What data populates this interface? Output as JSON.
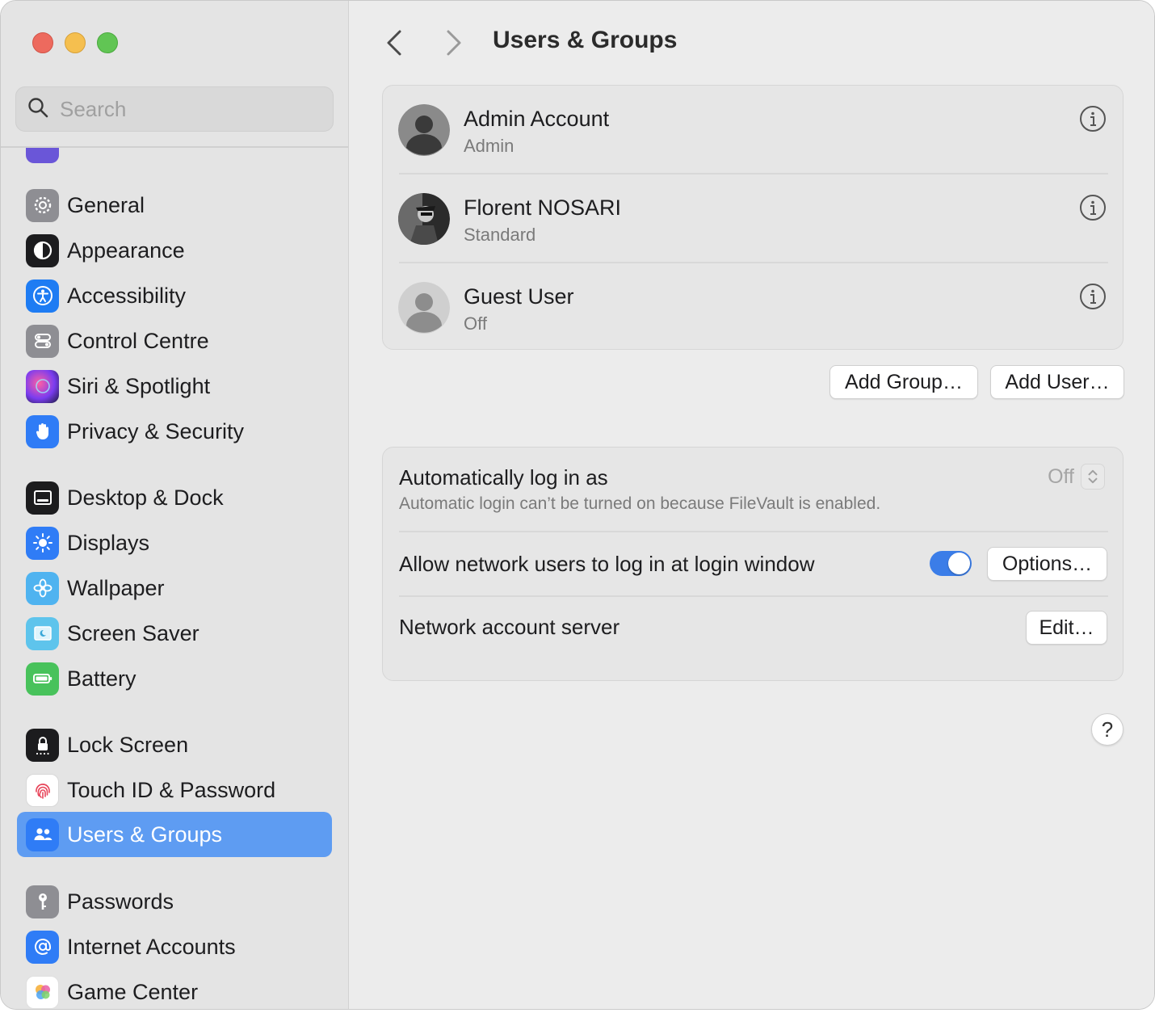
{
  "window": {
    "title": "Users & Groups"
  },
  "search": {
    "placeholder": "Search"
  },
  "sidebar": {
    "items": [
      {
        "label": "General",
        "icon": "gear-icon",
        "color": "#8e8e93"
      },
      {
        "label": "Appearance",
        "icon": "appearance-icon",
        "color": "#1c1c1e"
      },
      {
        "label": "Accessibility",
        "icon": "accessibility-icon",
        "color": "#1e7cf3"
      },
      {
        "label": "Control Centre",
        "icon": "control-centre-icon",
        "color": "#8e8e93"
      },
      {
        "label": "Siri & Spotlight",
        "icon": "siri-icon",
        "color": "#6a3fb5"
      },
      {
        "label": "Privacy & Security",
        "icon": "hand-icon",
        "color": "#2f7cf6"
      },
      {
        "label": "Desktop & Dock",
        "icon": "dock-icon",
        "color": "#1c1c1e"
      },
      {
        "label": "Displays",
        "icon": "sun-icon",
        "color": "#2f7cf6"
      },
      {
        "label": "Wallpaper",
        "icon": "flower-icon",
        "color": "#4fb3f0"
      },
      {
        "label": "Screen Saver",
        "icon": "screen-saver-icon",
        "color": "#5ec4ec"
      },
      {
        "label": "Battery",
        "icon": "battery-icon",
        "color": "#48c25b"
      },
      {
        "label": "Lock Screen",
        "icon": "lock-icon",
        "color": "#1c1c1e"
      },
      {
        "label": "Touch ID & Password",
        "icon": "fingerprint-icon",
        "color": "#ffffff"
      },
      {
        "label": "Users & Groups",
        "icon": "users-icon",
        "color": "#2f7cf6"
      },
      {
        "label": "Passwords",
        "icon": "key-icon",
        "color": "#8e8e93"
      },
      {
        "label": "Internet Accounts",
        "icon": "at-icon",
        "color": "#2f7cf6"
      },
      {
        "label": "Game Center",
        "icon": "game-center-icon",
        "color": "#ffffff"
      }
    ]
  },
  "users": [
    {
      "name": "Admin Account",
      "role": "Admin",
      "avatar": "default-avatar-icon"
    },
    {
      "name": "Florent NOSARI",
      "role": "Standard",
      "avatar": "photo-avatar"
    },
    {
      "name": "Guest User",
      "role": "Off",
      "avatar": "guest-avatar-icon"
    }
  ],
  "buttons": {
    "add_group": "Add Group…",
    "add_user": "Add User…",
    "options": "Options…",
    "edit": "Edit…",
    "help": "?"
  },
  "settings": {
    "auto_login": {
      "title": "Automatically log in as",
      "subtitle": "Automatic login can’t be turned on because FileVault is enabled.",
      "value": "Off"
    },
    "network_login": {
      "title": "Allow network users to log in at login window",
      "enabled": true
    },
    "network_server": {
      "title": "Network account server"
    }
  },
  "colors": {
    "accent": "#3b7de8",
    "selected_sidebar": "#5e9cf2"
  }
}
